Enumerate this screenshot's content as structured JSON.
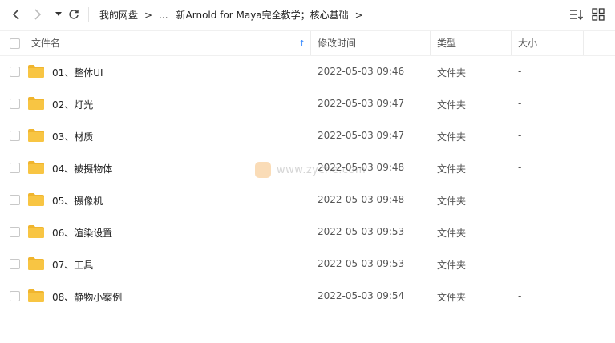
{
  "toolbar": {
    "back_icon": "chevron-left-icon",
    "forward_icon": "chevron-right-icon",
    "history_icon": "caret-down-icon",
    "refresh_icon": "refresh-icon",
    "breadcrumb": [
      "我的网盘",
      "...",
      "新Arnold for Maya完全教学；核心基础"
    ],
    "breadcrumb_separator": ">",
    "sort_icon": "sort-list-icon",
    "view_icon": "grid-view-icon"
  },
  "columns": {
    "name": "文件名",
    "modified": "修改时间",
    "type": "类型",
    "size": "大小",
    "sort_indicator": "↑"
  },
  "rows": [
    {
      "name": "01、整体UI",
      "modified": "2022-05-03 09:46",
      "type": "文件夹",
      "size": "-"
    },
    {
      "name": "02、灯光",
      "modified": "2022-05-03 09:47",
      "type": "文件夹",
      "size": "-"
    },
    {
      "name": "03、材质",
      "modified": "2022-05-03 09:47",
      "type": "文件夹",
      "size": "-"
    },
    {
      "name": "04、被摄物体",
      "modified": "2022-05-03 09:48",
      "type": "文件夹",
      "size": "-"
    },
    {
      "name": "05、摄像机",
      "modified": "2022-05-03 09:48",
      "type": "文件夹",
      "size": "-"
    },
    {
      "name": "06、渲染设置",
      "modified": "2022-05-03 09:53",
      "type": "文件夹",
      "size": "-"
    },
    {
      "name": "07、工具",
      "modified": "2022-05-03 09:53",
      "type": "文件夹",
      "size": "-"
    },
    {
      "name": "08、静物小案例",
      "modified": "2022-05-03 09:54",
      "type": "文件夹",
      "size": "-"
    }
  ],
  "watermark": "www.zyche.com",
  "colors": {
    "accent": "#3b8cff",
    "folder": "#f8c543",
    "folder_tab": "#f0b52e"
  }
}
